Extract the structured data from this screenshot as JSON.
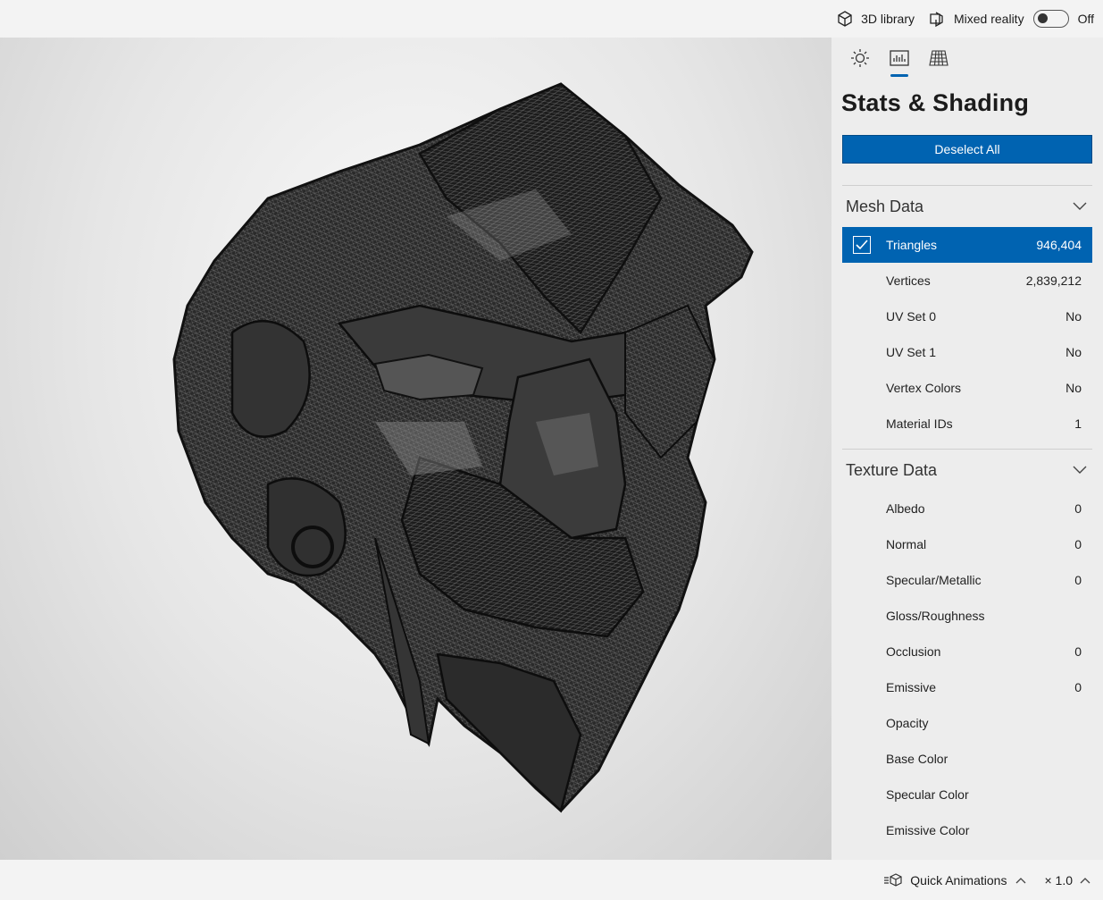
{
  "topbar": {
    "library_label": "3D library",
    "mixed_reality_label": "Mixed reality",
    "toggle_state": "Off"
  },
  "panel": {
    "title": "Stats & Shading",
    "deselect_label": "Deselect All",
    "mesh_section": "Mesh Data",
    "mesh_rows": [
      {
        "label": "Triangles",
        "value": "946,404"
      },
      {
        "label": "Vertices",
        "value": "2,839,212"
      },
      {
        "label": "UV Set 0",
        "value": "No"
      },
      {
        "label": "UV Set 1",
        "value": "No"
      },
      {
        "label": "Vertex Colors",
        "value": "No"
      },
      {
        "label": "Material IDs",
        "value": "1"
      }
    ],
    "texture_section": "Texture Data",
    "texture_rows": [
      {
        "label": "Albedo",
        "value": "0"
      },
      {
        "label": "Normal",
        "value": "0"
      },
      {
        "label": "Specular/Metallic",
        "value": "0"
      },
      {
        "label": "Gloss/Roughness",
        "value": ""
      },
      {
        "label": "Occlusion",
        "value": "0"
      },
      {
        "label": "Emissive",
        "value": "0"
      },
      {
        "label": "Opacity",
        "value": ""
      },
      {
        "label": "Base Color",
        "value": ""
      },
      {
        "label": "Specular Color",
        "value": ""
      },
      {
        "label": "Emissive Color",
        "value": ""
      }
    ]
  },
  "bottombar": {
    "animations_label": "Quick Animations",
    "speed_label": "× 1.0"
  },
  "colors": {
    "accent": "#0063b1",
    "panel_bg": "#ededed"
  }
}
